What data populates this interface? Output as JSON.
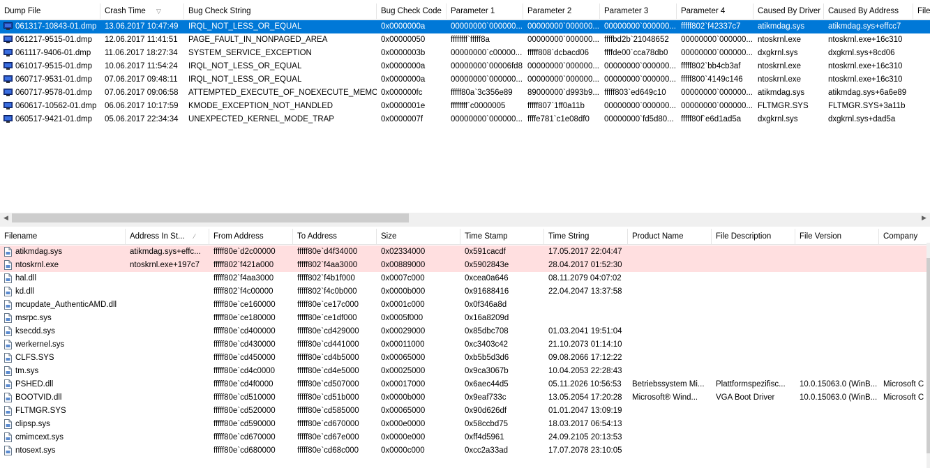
{
  "top": {
    "columns": [
      "Dump File",
      "Crash Time",
      "Bug Check String",
      "Bug Check Code",
      "Parameter 1",
      "Parameter 2",
      "Parameter 3",
      "Parameter 4",
      "Caused By Driver",
      "Caused By Address",
      "File"
    ],
    "rows": [
      [
        "061317-10843-01.dmp",
        "13.06.2017 10:47:49",
        "IRQL_NOT_LESS_OR_EQUAL",
        "0x0000000a",
        "00000000`000000...",
        "00000000`000000...",
        "00000000`000000...",
        "fffff802`f42337c7",
        "atikmdag.sys",
        "atikmdag.sys+effcc7"
      ],
      [
        "061217-9515-01.dmp",
        "12.06.2017 11:41:51",
        "PAGE_FAULT_IN_NONPAGED_AREA",
        "0x00000050",
        "ffffffff`fffff8a",
        "00000000`000000...",
        "ffffbd2b`21048652",
        "00000000`000000...",
        "ntoskrnl.exe",
        "ntoskrnl.exe+16c310"
      ],
      [
        "061117-9406-01.dmp",
        "11.06.2017 18:27:34",
        "SYSTEM_SERVICE_EXCEPTION",
        "0x0000003b",
        "00000000`c00000...",
        "fffff808`dcbacd06",
        "ffffde00`cca78db0",
        "00000000`000000...",
        "dxgkrnl.sys",
        "dxgkrnl.sys+8cd06"
      ],
      [
        "061017-9515-01.dmp",
        "10.06.2017 11:54:24",
        "IRQL_NOT_LESS_OR_EQUAL",
        "0x0000000a",
        "00000000`00006fd8",
        "00000000`000000...",
        "00000000`000000...",
        "fffff802`bb4cb3af",
        "ntoskrnl.exe",
        "ntoskrnl.exe+16c310"
      ],
      [
        "060717-9531-01.dmp",
        "07.06.2017 09:48:11",
        "IRQL_NOT_LESS_OR_EQUAL",
        "0x0000000a",
        "00000000`000000...",
        "00000000`000000...",
        "00000000`000000...",
        "fffff800`4149c146",
        "ntoskrnl.exe",
        "ntoskrnl.exe+16c310"
      ],
      [
        "060717-9578-01.dmp",
        "07.06.2017 09:06:58",
        "ATTEMPTED_EXECUTE_OF_NOEXECUTE_MEMO...",
        "0x000000fc",
        "fffff80a`3c356e89",
        "89000000`d993b9...",
        "fffff803`ed649c10",
        "00000000`000000...",
        "atikmdag.sys",
        "atikmdag.sys+6a6e89"
      ],
      [
        "060617-10562-01.dmp",
        "06.06.2017 10:17:59",
        "KMODE_EXCEPTION_NOT_HANDLED",
        "0x0000001e",
        "ffffffff`c0000005",
        "fffff807`1ff0a11b",
        "00000000`000000...",
        "00000000`000000...",
        "FLTMGR.SYS",
        "FLTMGR.SYS+3a11b"
      ],
      [
        "060517-9421-01.dmp",
        "05.06.2017 22:34:34",
        "UNEXPECTED_KERNEL_MODE_TRAP",
        "0x0000007f",
        "00000000`000000...",
        "ffffe781`c1e08df0",
        "00000000`fd5d80...",
        "fffff80f`e6d1ad5a",
        "dxgkrnl.sys",
        "dxgkrnl.sys+dad5a"
      ]
    ]
  },
  "bottom": {
    "columns": [
      "Filename",
      "Address In St...",
      "From Address",
      "To Address",
      "Size",
      "Time Stamp",
      "Time String",
      "Product Name",
      "File Description",
      "File Version",
      "Company"
    ],
    "rows": [
      [
        "atikmdag.sys",
        "atikmdag.sys+effc...",
        "fffff80e`d2c00000",
        "fffff80e`d4f34000",
        "0x02334000",
        "0x591cacdf",
        "17.05.2017 22:04:47",
        "",
        "",
        "",
        ""
      ],
      [
        "ntoskrnl.exe",
        "ntoskrnl.exe+197c7",
        "fffff802`f421a000",
        "fffff802`f4aa3000",
        "0x00889000",
        "0x5902843e",
        "28.04.2017 01:52:30",
        "",
        "",
        "",
        ""
      ],
      [
        "hal.dll",
        "",
        "fffff802`f4aa3000",
        "fffff802`f4b1f000",
        "0x0007c000",
        "0xcea0a646",
        "08.11.2079 04:07:02",
        "",
        "",
        "",
        ""
      ],
      [
        "kd.dll",
        "",
        "fffff802`f4c00000",
        "fffff802`f4c0b000",
        "0x0000b000",
        "0x91688416",
        "22.04.2047 13:37:58",
        "",
        "",
        "",
        ""
      ],
      [
        "mcupdate_AuthenticAMD.dll",
        "",
        "fffff80e`ce160000",
        "fffff80e`ce17c000",
        "0x0001c000",
        "0x0f346a8d",
        "",
        "",
        "",
        "",
        ""
      ],
      [
        "msrpc.sys",
        "",
        "fffff80e`ce180000",
        "fffff80e`ce1df000",
        "0x0005f000",
        "0x16a8209d",
        "",
        "",
        "",
        "",
        ""
      ],
      [
        "ksecdd.sys",
        "",
        "fffff80e`cd400000",
        "fffff80e`cd429000",
        "0x00029000",
        "0x85dbc708",
        "01.03.2041 19:51:04",
        "",
        "",
        "",
        ""
      ],
      [
        "werkernel.sys",
        "",
        "fffff80e`cd430000",
        "fffff80e`cd441000",
        "0x00011000",
        "0xc3403c42",
        "21.10.2073 01:14:10",
        "",
        "",
        "",
        ""
      ],
      [
        "CLFS.SYS",
        "",
        "fffff80e`cd450000",
        "fffff80e`cd4b5000",
        "0x00065000",
        "0xb5b5d3d6",
        "09.08.2066 17:12:22",
        "",
        "",
        "",
        ""
      ],
      [
        "tm.sys",
        "",
        "fffff80e`cd4c0000",
        "fffff80e`cd4e5000",
        "0x00025000",
        "0x9ca3067b",
        "10.04.2053 22:28:43",
        "",
        "",
        "",
        ""
      ],
      [
        "PSHED.dll",
        "",
        "fffff80e`cd4f0000",
        "fffff80e`cd507000",
        "0x00017000",
        "0x6aec44d5",
        "05.11.2026 10:56:53",
        "Betriebssystem Mi...",
        "Plattformspezifisc...",
        "10.0.15063.0 (WinB...",
        "Microsoft C"
      ],
      [
        "BOOTVID.dll",
        "",
        "fffff80e`cd510000",
        "fffff80e`cd51b000",
        "0x0000b000",
        "0x9eaf733c",
        "13.05.2054 17:20:28",
        "Microsoft® Wind...",
        "VGA Boot Driver",
        "10.0.15063.0 (WinB...",
        "Microsoft C"
      ],
      [
        "FLTMGR.SYS",
        "",
        "fffff80e`cd520000",
        "fffff80e`cd585000",
        "0x00065000",
        "0x90d626df",
        "01.01.2047 13:09:19",
        "",
        "",
        "",
        ""
      ],
      [
        "clipsp.sys",
        "",
        "fffff80e`cd590000",
        "fffff80e`cd670000",
        "0x000e0000",
        "0x58ccbd75",
        "18.03.2017 06:54:13",
        "",
        "",
        "",
        ""
      ],
      [
        "cmimcext.sys",
        "",
        "fffff80e`cd670000",
        "fffff80e`cd67e000",
        "0x0000e000",
        "0xff4d5961",
        "24.09.2105 20:13:53",
        "",
        "",
        "",
        ""
      ],
      [
        "ntosext.sys",
        "",
        "fffff80e`cd680000",
        "fffff80e`cd68c000",
        "0x0000c000",
        "0xcc2a33ad",
        "17.07.2078 23:10:05",
        "",
        "",
        "",
        ""
      ]
    ]
  },
  "colors": {
    "selected": "#0078d7",
    "highlight": "#ffdfe0",
    "icon": "#1e3f9e"
  },
  "icons": {
    "dump": "monitor-icon",
    "module": "file-icon",
    "sort": "sort-arrow-icon"
  }
}
